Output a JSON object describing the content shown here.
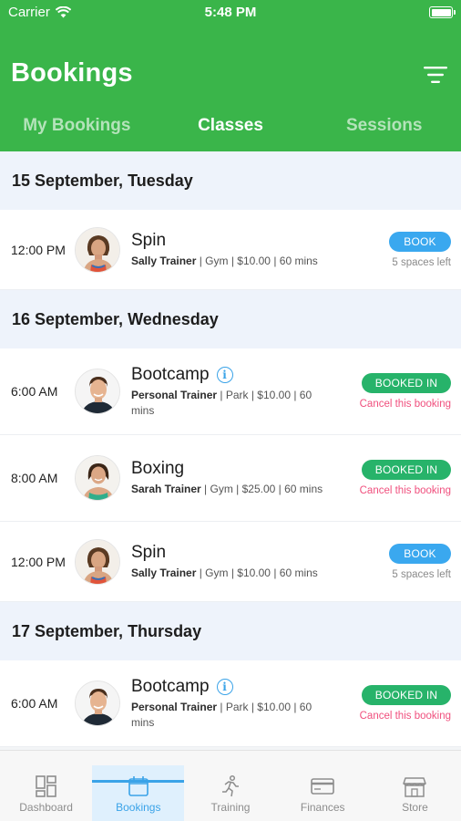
{
  "status_bar": {
    "carrier": "Carrier",
    "time": "5:48 PM"
  },
  "header": {
    "title": "Bookings",
    "tabs": [
      {
        "label": "My Bookings",
        "active": false
      },
      {
        "label": "Classes",
        "active": true
      },
      {
        "label": "Sessions",
        "active": false
      }
    ]
  },
  "sections": [
    {
      "date": "15 September, Tuesday",
      "items": [
        {
          "time": "12:00 PM",
          "name": "Spin",
          "trainer": "Sally Trainer",
          "details": " | Gym | $10.00 | 60 mins",
          "action": "BOOK",
          "sub": "5 spaces left",
          "info": false
        }
      ]
    },
    {
      "date": "16 September, Wednesday",
      "items": [
        {
          "time": "6:00 AM",
          "name": "Bootcamp",
          "trainer": "Personal Trainer",
          "details": " | Park | $10.00 | 60 mins",
          "action": "BOOKED IN",
          "sub": "Cancel this booking",
          "info": true
        },
        {
          "time": "8:00 AM",
          "name": "Boxing",
          "trainer": "Sarah Trainer",
          "details": " | Gym | $25.00 | 60 mins",
          "action": "BOOKED IN",
          "sub": "Cancel this booking",
          "info": false
        },
        {
          "time": "12:00 PM",
          "name": "Spin",
          "trainer": "Sally Trainer",
          "details": " | Gym | $10.00 | 60 mins",
          "action": "BOOK",
          "sub": "5 spaces left",
          "info": false
        }
      ]
    },
    {
      "date": "17 September, Thursday",
      "items": [
        {
          "time": "6:00 AM",
          "name": "Bootcamp",
          "trainer": "Personal Trainer",
          "details": " | Park | $10.00 | 60 mins",
          "action": "BOOKED IN",
          "sub": "Cancel this booking",
          "info": true
        }
      ]
    }
  ],
  "bottom_nav": [
    {
      "label": "Dashboard",
      "icon": "dashboard-grid-icon",
      "active": false
    },
    {
      "label": "Bookings",
      "icon": "calendar-icon",
      "active": true
    },
    {
      "label": "Training",
      "icon": "runner-icon",
      "active": false
    },
    {
      "label": "Finances",
      "icon": "credit-card-icon",
      "active": false
    },
    {
      "label": "Store",
      "icon": "store-icon",
      "active": false
    }
  ],
  "colors": {
    "header_green": "#3ab54a",
    "book_blue": "#3aa8ef",
    "booked_green": "#27b36a",
    "cancel_pink": "#f0507e",
    "nav_active": "#3aa3e8"
  }
}
